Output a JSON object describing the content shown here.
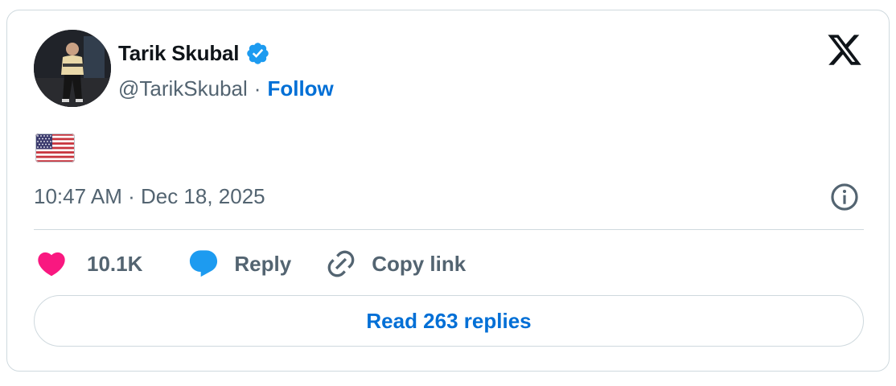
{
  "tweet": {
    "author": {
      "name": "Tarik Skubal",
      "handle": "@TarikSkubal",
      "verified": true,
      "follow_label": "Follow",
      "separator": "·"
    },
    "body_emoji": "🇺🇸",
    "timestamp": "10:47 AM · Dec 18, 2025",
    "actions": {
      "like_count": "10.1K",
      "reply_label": "Reply",
      "copy_link_label": "Copy link"
    },
    "read_replies_label": "Read 263 replies"
  },
  "icons": {
    "platform_logo": "x-logo-icon",
    "verified": "verified-badge-icon",
    "info": "info-icon",
    "like": "heart-icon",
    "reply": "speech-bubble-icon",
    "copy_link": "link-icon",
    "flag": "us-flag-icon"
  },
  "colors": {
    "text_primary": "#0f1419",
    "text_secondary": "#536471",
    "accent_blue": "#006fd6",
    "verified_blue": "#1d9bf0",
    "like_pink": "#f91880",
    "border": "#cfd9de"
  }
}
